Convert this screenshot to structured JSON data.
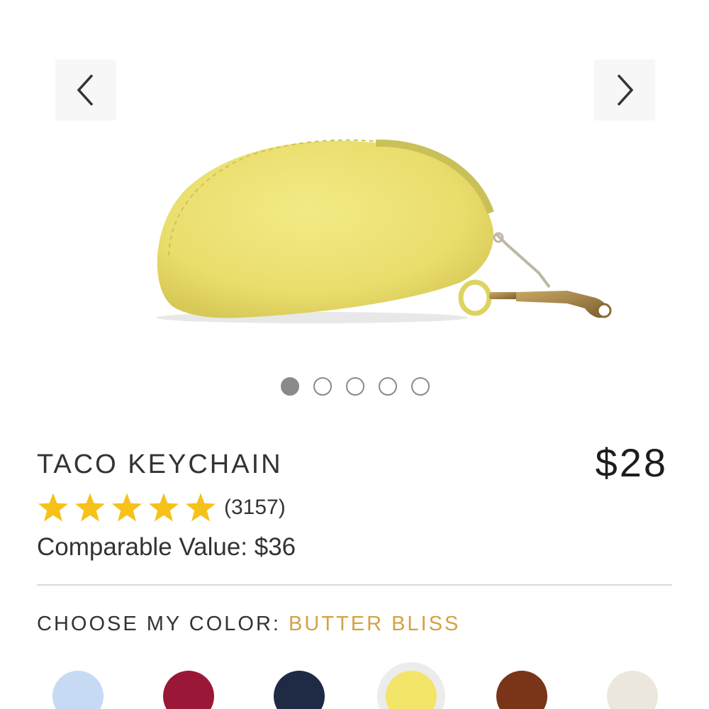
{
  "gallery": {
    "prev_icon": "chevron-left-icon",
    "next_icon": "chevron-right-icon",
    "image_alt": "Yellow leather taco-shaped keychain pouch with brass clasp",
    "slide_count": 5,
    "active_slide": 1
  },
  "product": {
    "title": "TACO KEYCHAIN",
    "price": "$28",
    "rating_stars": 5,
    "review_count": "(3157)",
    "comparable_value": "Comparable Value: $36"
  },
  "color_picker": {
    "label": "CHOOSE MY COLOR: ",
    "selected_name": "BUTTER BLISS",
    "swatches": [
      {
        "color": "#c6dbf3"
      },
      {
        "color": "#9b1737"
      },
      {
        "color": "#1f2a44"
      },
      {
        "color": "#f3e46a",
        "selected": true
      },
      {
        "color": "#7a3418"
      },
      {
        "color": "#ece7dc"
      }
    ]
  },
  "colors": {
    "star": "#f6c21a",
    "accent": "#d4a243",
    "product_yellow": "#ece37a"
  }
}
